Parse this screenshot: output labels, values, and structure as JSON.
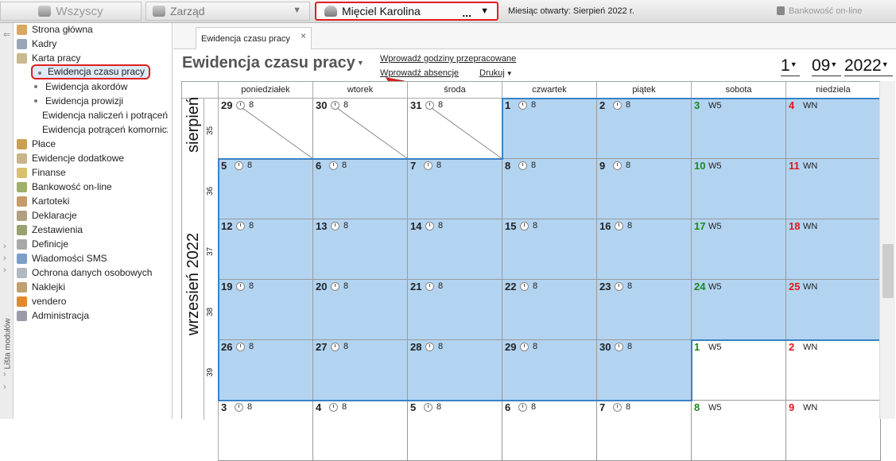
{
  "topbar": {
    "all_label": "Wszyscy",
    "zarzad_label": "Zarząd",
    "employee_label": "Mięciel Karolina",
    "employee_dots": "...",
    "month_open": "Miesiąc otwarty: Sierpień 2022 r.",
    "bank_label": "Bankowość on-line"
  },
  "left_strip": {
    "label": "Lista modułów"
  },
  "sidebar": {
    "items": [
      {
        "label": "Strona główna",
        "icon": "home-icon"
      },
      {
        "label": "Kadry",
        "icon": "people-icon"
      },
      {
        "label": "Karta pracy",
        "icon": "timecard-icon"
      }
    ],
    "karta_sub": [
      {
        "label": "Ewidencja czasu pracy"
      },
      {
        "label": "Ewidencja akordów"
      },
      {
        "label": "Ewidencja prowizji"
      },
      {
        "label": "Ewidencja naliczeń i potrąceń"
      },
      {
        "label": "Ewidencja potrąceń komorniczych"
      }
    ],
    "modules": [
      {
        "label": "Płace",
        "icon": "payroll-icon"
      },
      {
        "label": "Ewidencje dodatkowe",
        "icon": "records-icon"
      },
      {
        "label": "Finanse",
        "icon": "finance-icon"
      },
      {
        "label": "Bankowość on-line",
        "icon": "bank-icon"
      },
      {
        "label": "Kartoteki",
        "icon": "files-icon"
      },
      {
        "label": "Deklaracje",
        "icon": "declarations-icon"
      },
      {
        "label": "Zestawienia",
        "icon": "reports-icon"
      },
      {
        "label": "Definicje",
        "icon": "definitions-icon"
      },
      {
        "label": "Wiadomości SMS",
        "icon": "sms-icon"
      },
      {
        "label": "Ochrona danych osobowych",
        "icon": "shield-icon"
      },
      {
        "label": "Naklejki",
        "icon": "sticker-icon"
      },
      {
        "label": "vendero",
        "icon": "gear-icon"
      },
      {
        "label": "Administracja",
        "icon": "admin-icon"
      }
    ]
  },
  "tab": {
    "label": "Ewidencja czasu pracy",
    "close": "×"
  },
  "header": {
    "title": "Ewidencja czasu pracy",
    "link_hours": "Wprowadź godziny przepracowane",
    "link_absence": "Wprowadź absencje",
    "link_print": "Drukuj",
    "day": "1",
    "month": "09",
    "year": "2022"
  },
  "calendar": {
    "weekdays": [
      "poniedziałek",
      "wtorek",
      "środa",
      "czwartek",
      "piątek",
      "sobota",
      "niedziela"
    ],
    "months": {
      "prev": "sierpień",
      "curr": "wrzesień 2022"
    },
    "weeks": [
      {
        "num": "35",
        "days": [
          {
            "d": "29",
            "h": "8",
            "type": "prev"
          },
          {
            "d": "30",
            "h": "8",
            "type": "prev"
          },
          {
            "d": "31",
            "h": "8",
            "type": "prev"
          },
          {
            "d": "1",
            "h": "8",
            "type": "work",
            "sel": true
          },
          {
            "d": "2",
            "h": "8",
            "type": "work",
            "sel": true
          },
          {
            "d": "3",
            "code": "W5",
            "type": "sat",
            "sel": true
          },
          {
            "d": "4",
            "code": "WN",
            "type": "sun",
            "sel": true
          }
        ]
      },
      {
        "num": "36",
        "days": [
          {
            "d": "5",
            "h": "8",
            "type": "work",
            "sel": true
          },
          {
            "d": "6",
            "h": "8",
            "type": "work",
            "sel": true
          },
          {
            "d": "7",
            "h": "8",
            "type": "work",
            "sel": true
          },
          {
            "d": "8",
            "h": "8",
            "type": "work",
            "sel": true
          },
          {
            "d": "9",
            "h": "8",
            "type": "work",
            "sel": true
          },
          {
            "d": "10",
            "code": "W5",
            "type": "sat",
            "sel": true
          },
          {
            "d": "11",
            "code": "WN",
            "type": "sun",
            "sel": true
          }
        ]
      },
      {
        "num": "37",
        "days": [
          {
            "d": "12",
            "h": "8",
            "type": "work",
            "sel": true
          },
          {
            "d": "13",
            "h": "8",
            "type": "work",
            "sel": true
          },
          {
            "d": "14",
            "h": "8",
            "type": "work",
            "sel": true
          },
          {
            "d": "15",
            "h": "8",
            "type": "work",
            "sel": true
          },
          {
            "d": "16",
            "h": "8",
            "type": "work",
            "sel": true
          },
          {
            "d": "17",
            "code": "W5",
            "type": "sat",
            "sel": true
          },
          {
            "d": "18",
            "code": "WN",
            "type": "sun",
            "sel": true
          }
        ]
      },
      {
        "num": "38",
        "days": [
          {
            "d": "19",
            "h": "8",
            "type": "work",
            "sel": true
          },
          {
            "d": "20",
            "h": "8",
            "type": "work",
            "sel": true
          },
          {
            "d": "21",
            "h": "8",
            "type": "work",
            "sel": true
          },
          {
            "d": "22",
            "h": "8",
            "type": "work",
            "sel": true
          },
          {
            "d": "23",
            "h": "8",
            "type": "work",
            "sel": true
          },
          {
            "d": "24",
            "code": "W5",
            "type": "sat",
            "sel": true
          },
          {
            "d": "25",
            "code": "WN",
            "type": "sun",
            "sel": true
          }
        ]
      },
      {
        "num": "39",
        "days": [
          {
            "d": "26",
            "h": "8",
            "type": "work",
            "sel": true
          },
          {
            "d": "27",
            "h": "8",
            "type": "work",
            "sel": true
          },
          {
            "d": "28",
            "h": "8",
            "type": "work",
            "sel": true
          },
          {
            "d": "29",
            "h": "8",
            "type": "work",
            "sel": true
          },
          {
            "d": "30",
            "h": "8",
            "type": "work",
            "sel": true
          },
          {
            "d": "1",
            "code": "W5",
            "type": "sat"
          },
          {
            "d": "2",
            "code": "WN",
            "type": "sun"
          }
        ]
      },
      {
        "num": "",
        "days": [
          {
            "d": "3",
            "h": "8",
            "type": "work"
          },
          {
            "d": "4",
            "h": "8",
            "type": "work"
          },
          {
            "d": "5",
            "h": "8",
            "type": "work"
          },
          {
            "d": "6",
            "h": "8",
            "type": "work"
          },
          {
            "d": "7",
            "h": "8",
            "type": "work"
          },
          {
            "d": "8",
            "code": "W5",
            "type": "sat"
          },
          {
            "d": "9",
            "code": "WN",
            "type": "sun"
          }
        ]
      }
    ]
  },
  "colors": {
    "selected_bg": "#b3d4f1",
    "highlight_red": "#e02020",
    "saturday": "#1a8a1a",
    "sunday": "#e01818"
  }
}
